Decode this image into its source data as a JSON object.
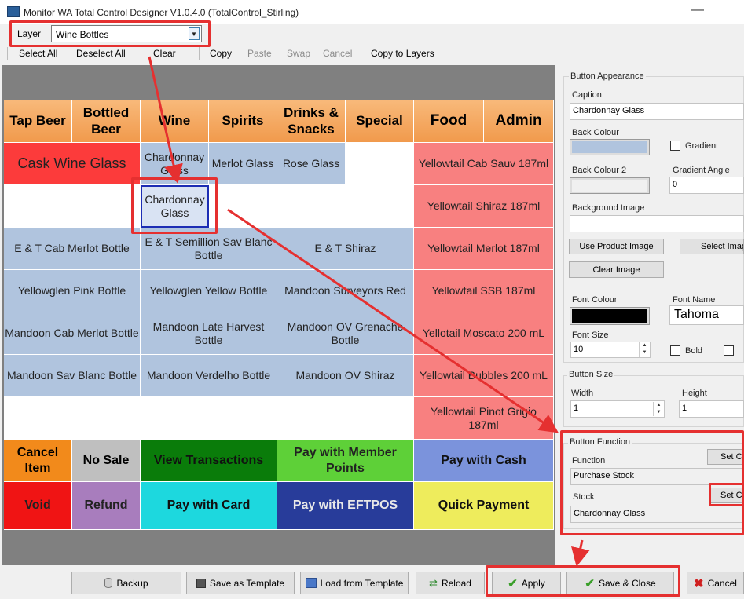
{
  "window": {
    "title": "Monitor WA Total Control Designer V1.0.4.0  (TotalControl_Stirling)",
    "minimize_glyph": "—"
  },
  "layer": {
    "label": "Layer",
    "value": "Wine Bottles"
  },
  "toolbar": {
    "select_all": "Select All",
    "deselect_all": "Deselect All",
    "clear": "Clear",
    "copy": "Copy",
    "paste": "Paste",
    "swap": "Swap",
    "cancel": "Cancel",
    "copy_to_layers": "Copy to Layers"
  },
  "tabs": [
    "Tap Beer",
    "Bottled Beer",
    "Wine",
    "Spirits",
    "Drinks & Snacks",
    "Special",
    "Food",
    "Admin"
  ],
  "grid": {
    "cask": "Cask Wine Glass",
    "chardonnay_glass": "Chardonnay Glass",
    "merlot_glass": "Merlot Glass",
    "rose_glass": "Rose Glass",
    "selected_chardonnay": "Chardonnay Glass",
    "et_cab_merlot": "E & T Cab Merlot Bottle",
    "et_semillion": "E & T Semillion Sav Blanc Bottle",
    "et_shiraz": "E & T Shiraz",
    "yellowglen_pink": "Yellowglen Pink Bottle",
    "yellowglen_yellow": "Yellowglen Yellow Bottle",
    "mandoon_surveyors": "Mandoon Surveyors Red",
    "mandoon_cab_merlot": "Mandoon Cab Merlot Bottle",
    "mandoon_late_harvest": "Mandoon Late Harvest Bottle",
    "mandoon_grenache": "Mandoon OV Grenache Bottle",
    "mandoon_sav_blanc": "Mandoon Sav Blanc Bottle",
    "mandoon_verdelho": "Mandoon Verdelho Bottle",
    "mandoon_ov_shiraz": "Mandoon OV Shiraz",
    "yt_cab_sauv": "Yellowtail Cab Sauv 187ml",
    "yt_shiraz": "Yellowtail Shiraz 187ml",
    "yt_merlot": "Yellowtail Merlot 187ml",
    "yt_ssb": "Yellowtail SSB 187ml",
    "yt_moscato": "Yellotail Moscato 200 mL",
    "yt_bubbles": "Yellowtail Bubbles 200 mL",
    "yt_pinot": "Yellowtail Pinot Grigio 187ml"
  },
  "function_buttons": {
    "cancel_item": "Cancel Item",
    "no_sale": "No Sale",
    "view_transactions": "View Transactions",
    "pay_member": "Pay with Member Points",
    "pay_cash": "Pay with Cash",
    "void": "Void",
    "refund": "Refund",
    "pay_card": "Pay with Card",
    "pay_eftpos": "Pay with EFTPOS",
    "quick_payment": "Quick Payment"
  },
  "appearance": {
    "group": "Button Appearance",
    "caption_label": "Caption",
    "caption_value": "Chardonnay Glass",
    "back_colour_label": "Back Colour",
    "gradient_label": "Gradient",
    "back_colour2_label": "Back Colour 2",
    "gradient_angle_label": "Gradient Angle",
    "gradient_angle_value": "0",
    "bg_image_label": "Background Image",
    "use_product_image": "Use Product Image",
    "select_image": "Select Image",
    "clear_image": "Clear Image",
    "font_colour_label": "Font Colour",
    "font_name_label": "Font Name",
    "font_name_value": "Tahoma",
    "font_size_label": "Font Size",
    "font_size_value": "10",
    "bold_label": "Bold"
  },
  "size": {
    "group": "Button Size",
    "width_label": "Width",
    "width_value": "1",
    "height_label": "Height",
    "height_value": "1"
  },
  "function": {
    "group": "Button Function",
    "function_label": "Function",
    "set_function": "Set Co",
    "function_value": "Purchase Stock",
    "stock_label": "Stock",
    "set_stock": "Set Co",
    "stock_value": "Chardonnay Glass"
  },
  "bottom": {
    "backup": "Backup",
    "save_template": "Save as Template",
    "load_template": "Load from Template",
    "reload": "Reload",
    "apply": "Apply",
    "save_close": "Save & Close",
    "cancel": "Cancel"
  },
  "colors": {
    "tab_orange": "#f3a55e",
    "blue_cell": "#b0c4de",
    "red_cell": "#f88080",
    "highlight_red": "#e53030"
  },
  "icons": [
    "app-icon",
    "chevron-down-icon",
    "database-icon",
    "save-icon",
    "load-icon",
    "reload-icon",
    "checkmark-icon",
    "close-x-icon"
  ]
}
